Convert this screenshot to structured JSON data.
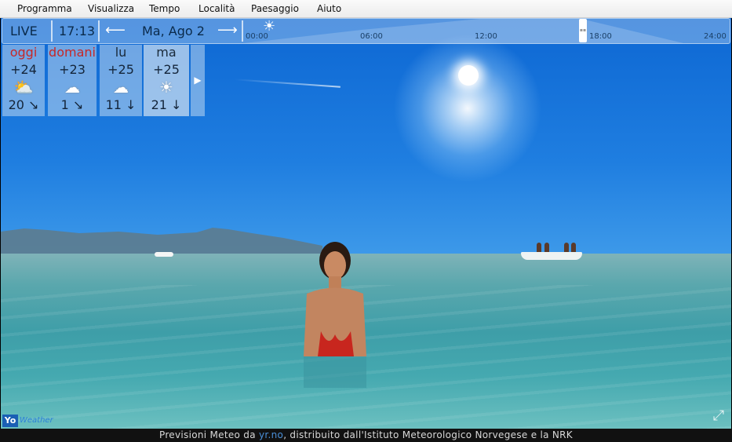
{
  "menu": [
    "Programma",
    "Visualizza",
    "Tempo",
    "Località",
    "Paesaggio",
    "Aiuto"
  ],
  "topbar": {
    "live_label": "LIVE",
    "time": "17:13",
    "date": "Ma, Ago 2",
    "prev_icon": "arrow-left-icon",
    "next_icon": "arrow-right-icon",
    "timeline_ticks": [
      "00:00",
      "06:00",
      "12:00",
      "18:00",
      "24:00"
    ],
    "current_weather_icon": "sun-icon"
  },
  "forecast": [
    {
      "day": "oggi",
      "temp": "+24",
      "icon": "partly-cloudy-icon",
      "wind": "20 ↘"
    },
    {
      "day": "domani",
      "temp": "+23",
      "icon": "rain-cloud-icon",
      "wind": "1 ↘"
    },
    {
      "day": "lu",
      "temp": "+25",
      "icon": "rain-cloud-icon",
      "wind": "11 ↓"
    },
    {
      "day": "ma",
      "temp": "+25",
      "icon": "sun-icon",
      "wind": "21 ↓"
    }
  ],
  "logo": {
    "badge": "Yo",
    "text": "Weather"
  },
  "footer": {
    "prefix": "Previsioni Meteo da ",
    "link": "yr.no",
    "suffix": ", distribuito dall'Istituto Meteorologico Norvegese e la NRK"
  },
  "colors": {
    "accent_red": "#c62828",
    "link_blue": "#4a90d9",
    "sky": "#1f7ee0"
  }
}
